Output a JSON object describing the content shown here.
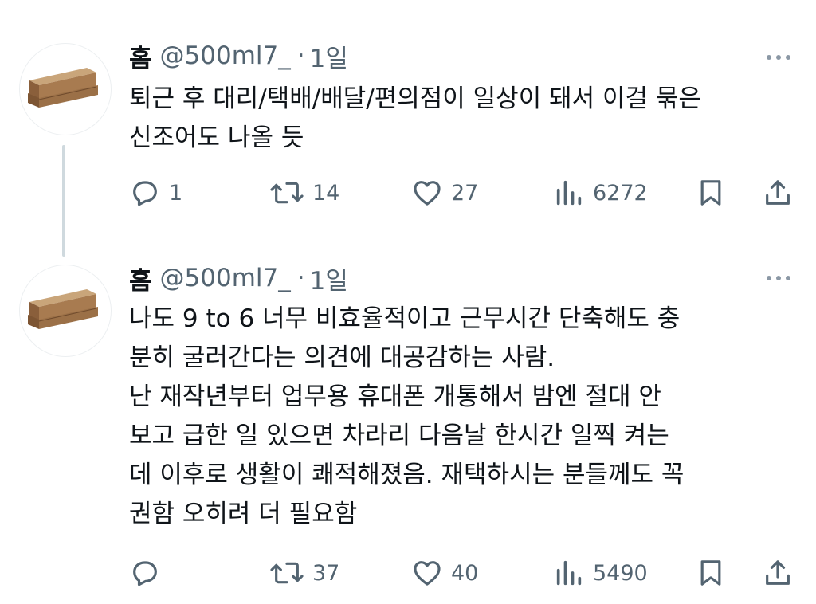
{
  "tweets": [
    {
      "name": "홈",
      "handle": "@500ml7_",
      "separator": "·",
      "time": "1일",
      "lines": [
        "퇴근 후 대리/택배/배달/편의점이 일상이 돼서 이걸 묶은",
        "신조어도 나올 듯"
      ],
      "replies": "1",
      "retweets": "14",
      "likes": "27",
      "views": "6272"
    },
    {
      "name": "홈",
      "handle": "@500ml7_",
      "separator": "·",
      "time": "1일",
      "lines": [
        "나도 9 to 6 너무 비효율적이고 근무시간 단축해도 충",
        "분히 굴러간다는 의견에 대공감하는 사람.",
        "난 재작년부터 업무용 휴대폰 개통해서 밤엔 절대 안",
        "보고 급한 일 있으면 차라리 다음날 한시간 일찍 켜는",
        "데 이후로 생활이 쾌적해졌음. 재택하시는 분들께도 꼭",
        "권함 오히려 더 필요함"
      ],
      "replies": "",
      "retweets": "37",
      "likes": "40",
      "views": "5490"
    }
  ],
  "icons": {
    "reply": "reply-icon",
    "retweet": "retweet-icon",
    "like": "heart-icon",
    "views": "views-icon",
    "bookmark": "bookmark-icon",
    "share": "share-icon",
    "more": "more-icon",
    "avatar": "coffin-avatar"
  },
  "colors": {
    "text": "#0f1419",
    "secondary": "#536471",
    "icon": "#536471",
    "thread_line": "#cfd9de"
  }
}
